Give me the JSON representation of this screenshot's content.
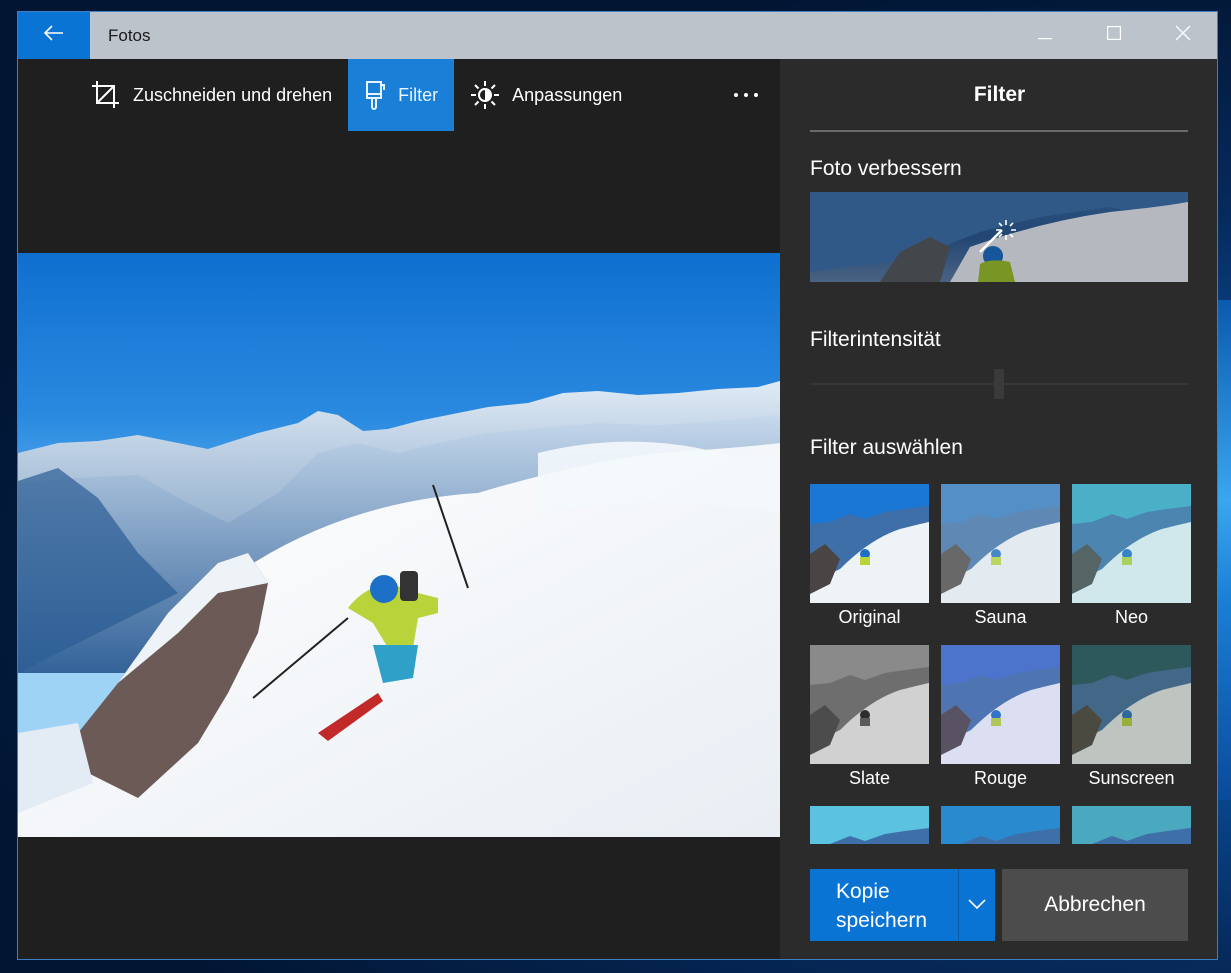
{
  "window": {
    "title": "Fotos",
    "back_icon": "arrow-left-icon",
    "controls": [
      "minimize-icon",
      "maximize-icon",
      "close-icon"
    ]
  },
  "toolbar": {
    "items": [
      {
        "label": "Zuschneiden und drehen",
        "icon": "crop-rotate-icon",
        "active": false
      },
      {
        "label": "Filter",
        "icon": "paintbrush-icon",
        "active": true
      },
      {
        "label": "Anpassungen",
        "icon": "brightness-icon",
        "active": false
      }
    ],
    "more_icon": "more-ellipsis-icon"
  },
  "panel": {
    "title": "Filter",
    "enhance": {
      "label": "Foto verbessern",
      "icon": "magic-wand-icon"
    },
    "intensity": {
      "label": "Filterintensität",
      "value_fraction": 0.5,
      "enabled": false
    },
    "filters": {
      "label": "Filter auswählen",
      "items": [
        {
          "name": "Original",
          "selected": true
        },
        {
          "name": "Sauna",
          "selected": false
        },
        {
          "name": "Neo",
          "selected": false
        },
        {
          "name": "Slate",
          "selected": false
        },
        {
          "name": "Rouge",
          "selected": false
        },
        {
          "name": "Sunscreen",
          "selected": false
        },
        {
          "name": "",
          "selected": false
        },
        {
          "name": "",
          "selected": false
        },
        {
          "name": "",
          "selected": false
        }
      ]
    },
    "save": {
      "line1": "Kopie",
      "line2": "speichern",
      "dropdown_icon": "chevron-down-icon"
    },
    "cancel": "Abbrechen"
  },
  "colors": {
    "accent": "#0a74d4",
    "active_tool": "#1a7fd6",
    "titlebar": "#bcc3cb",
    "panel_bg": "#2b2b2b",
    "editor_bg": "#1f1f1f",
    "cancel_bg": "#4c4c4c"
  }
}
